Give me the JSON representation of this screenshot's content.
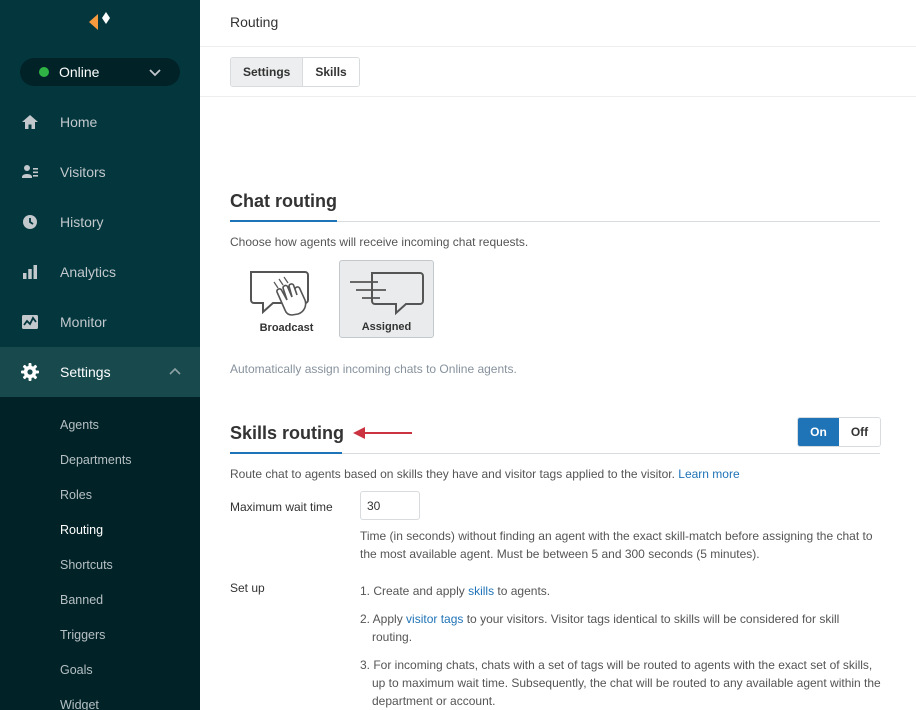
{
  "sidebar": {
    "status": "Online",
    "nav": [
      {
        "label": "Home",
        "icon": "home-icon"
      },
      {
        "label": "Visitors",
        "icon": "visitors-icon"
      },
      {
        "label": "History",
        "icon": "clock-icon"
      },
      {
        "label": "Analytics",
        "icon": "bar-chart-icon"
      },
      {
        "label": "Monitor",
        "icon": "monitor-icon"
      },
      {
        "label": "Settings",
        "icon": "gear-icon"
      }
    ],
    "sub": [
      "Agents",
      "Departments",
      "Roles",
      "Routing",
      "Shortcuts",
      "Banned",
      "Triggers",
      "Goals",
      "Widget"
    ]
  },
  "header": {
    "title": "Routing"
  },
  "tabs": [
    "Settings",
    "Skills"
  ],
  "chat_routing": {
    "title": "Chat routing",
    "description": "Choose how agents will receive incoming chat requests.",
    "options": [
      "Broadcast",
      "Assigned"
    ],
    "selected_note": "Automatically assign incoming chats to Online agents."
  },
  "skills_routing": {
    "title": "Skills routing",
    "toggle_on": "On",
    "toggle_off": "Off",
    "description": "Route chat to agents based on skills they have and visitor tags applied to the visitor.",
    "learn_more": "Learn more",
    "max_wait_label": "Maximum wait time",
    "max_wait_value": "30",
    "max_wait_help": "Time (in seconds) without finding an agent with the exact skill-match before assigning the chat to the most available agent. Must be between 5 and 300 seconds (5 minutes).",
    "setup_label": "Set up",
    "step1_a": "1. Create and apply ",
    "step1_link": "skills",
    "step1_b": " to agents.",
    "step2_a": "2. Apply ",
    "step2_link": "visitor tags",
    "step2_b": " to your visitors. Visitor tags identical to skills will be considered for skill routing.",
    "step3": "3. For incoming chats, chats with a set of tags will be routed to agents with the exact set of skills, up to maximum wait time. Subsequently, the chat will be routed to any available agent within the department or account."
  },
  "colors": {
    "sidebar": "#03363d",
    "accent": "#1f73b7",
    "online": "#2fb344",
    "arrow": "#cc3340",
    "logo": "#f79a3e"
  }
}
